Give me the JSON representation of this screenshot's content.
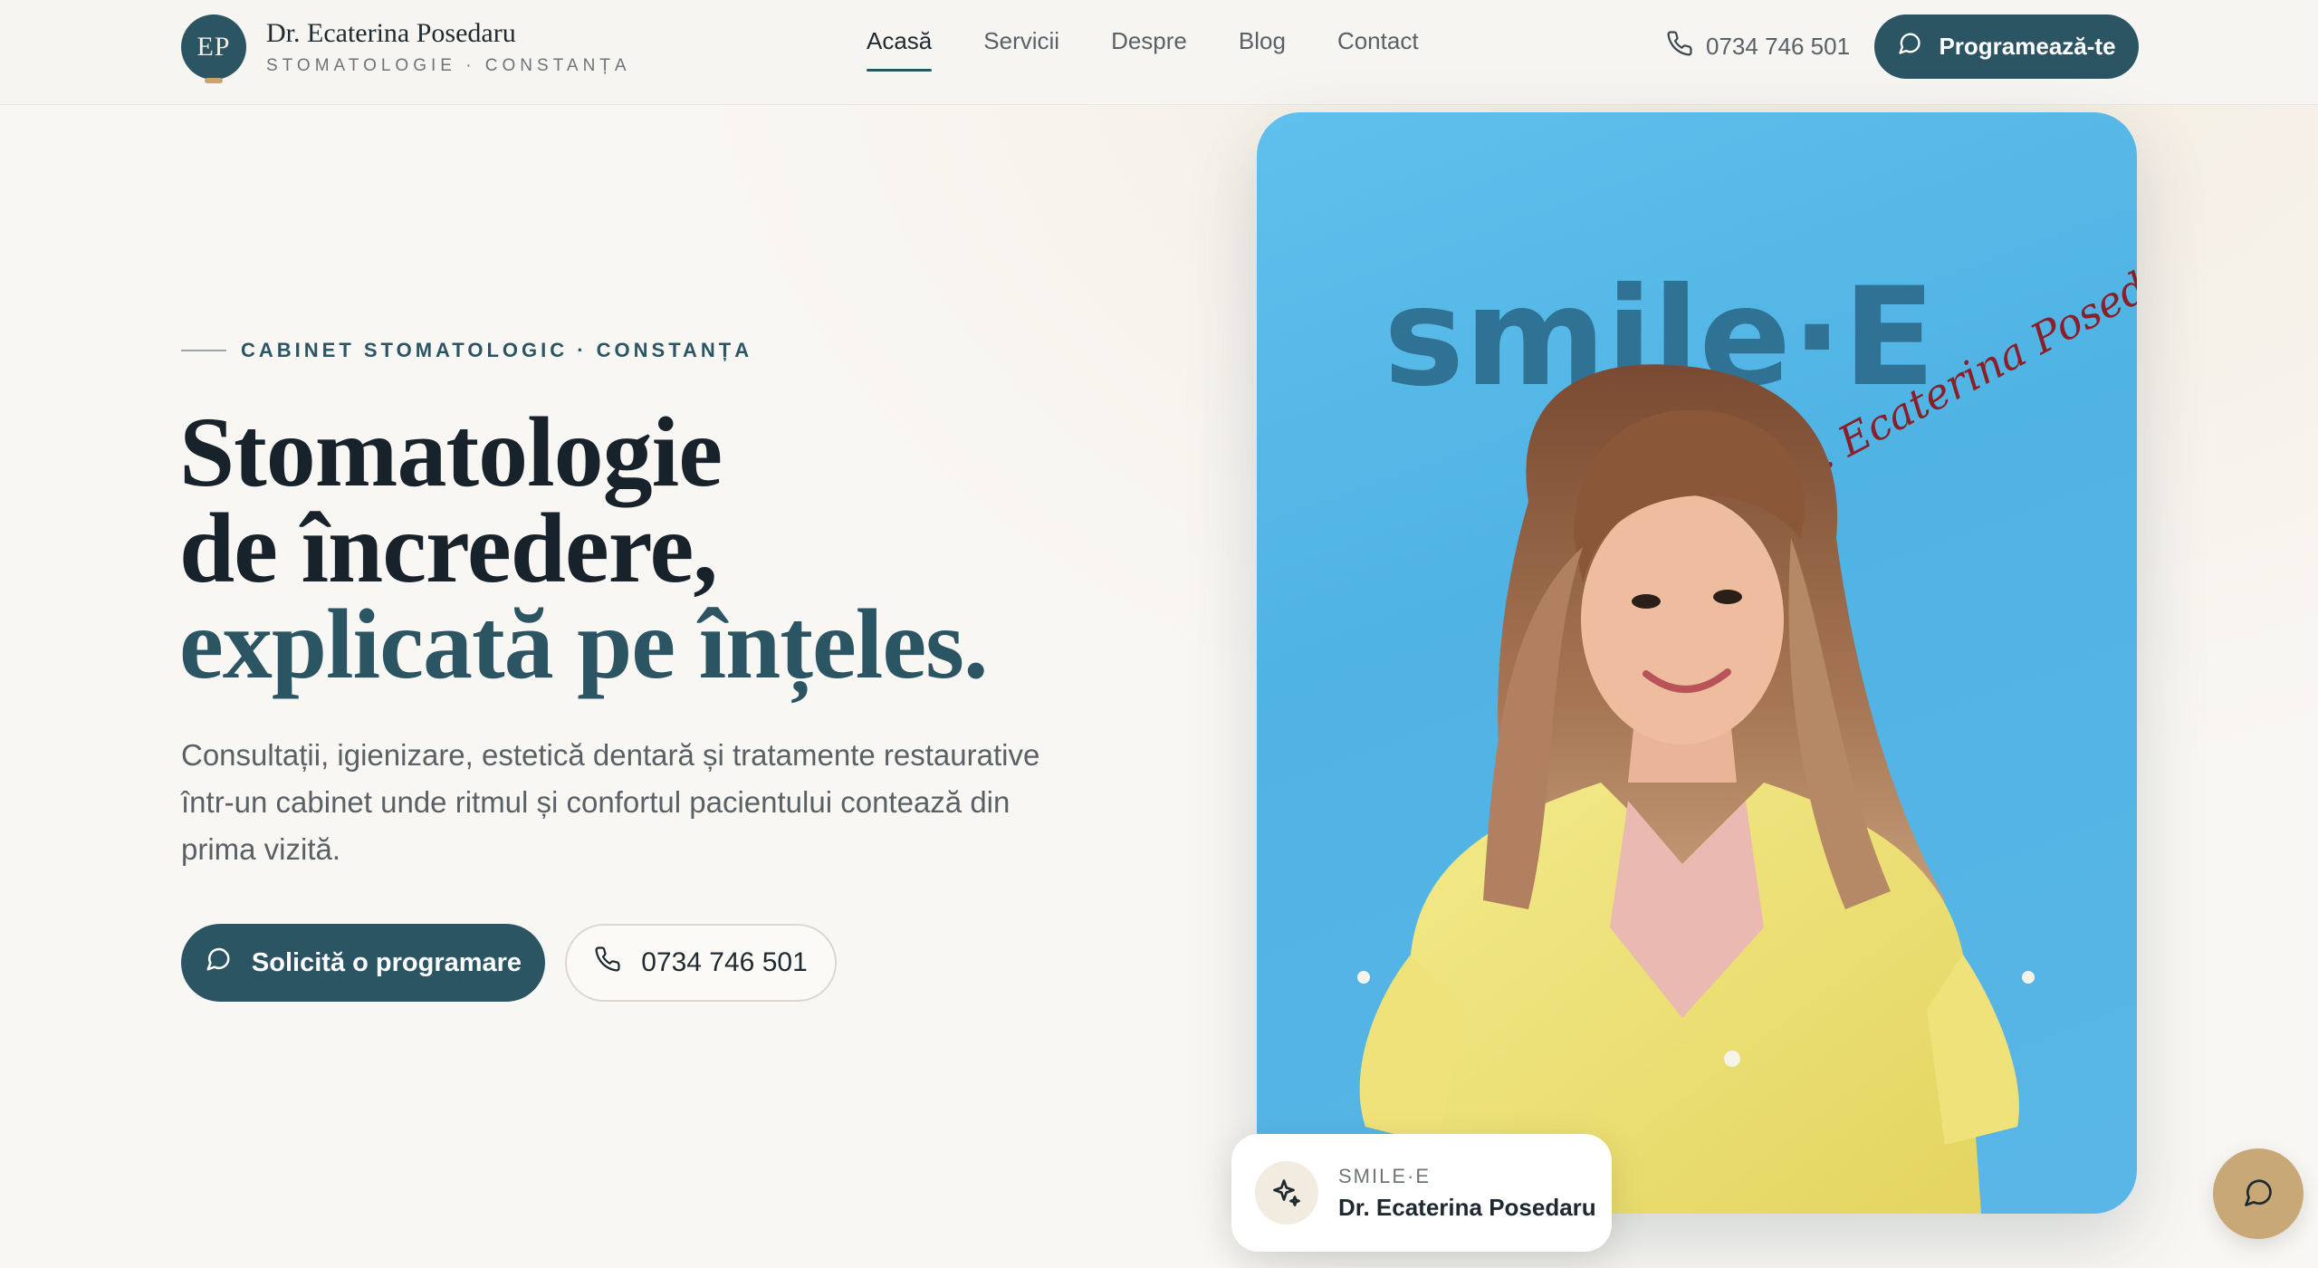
{
  "header": {
    "logo_initials": "EP",
    "brand_name": "Dr. Ecaterina Posedaru",
    "brand_subtitle": "STOMATOLOGIE · CONSTANȚA",
    "nav": [
      {
        "label": "Acasă",
        "active": true
      },
      {
        "label": "Servicii",
        "active": false
      },
      {
        "label": "Despre",
        "active": false
      },
      {
        "label": "Blog",
        "active": false
      },
      {
        "label": "Contact",
        "active": false
      }
    ],
    "phone": "0734 746 501",
    "cta_label": "Programează-te"
  },
  "hero": {
    "eyebrow": "CABINET STOMATOLOGIC · CONSTANȚA",
    "title_line1": "Stomatologie",
    "title_line2": "de încredere,",
    "title_line3": "explicată pe înțeles.",
    "lead": "Consultații, igienizare, estetică dentară și tratamente restaurative într-un cabinet unde ritmul și confortul pacientului contează din prima vizită.",
    "primary_button": "Solicită o programare",
    "secondary_button": "0734 746 501"
  },
  "photo": {
    "wall_logo": "smile·E",
    "wall_signature": "Dr. Ecaterina Posedaru"
  },
  "signature_card": {
    "label": "SMILE·E",
    "name": "Dr. Ecaterina Posedaru"
  },
  "colors": {
    "brand": "#2c5563",
    "gold": "#c9a878",
    "background": "#f9f7f3",
    "photo_wall": "#5ab9e8"
  },
  "icons": {
    "phone": "phone-icon",
    "chat": "chat-bubble-icon",
    "sparkle": "sparkle-icon"
  }
}
